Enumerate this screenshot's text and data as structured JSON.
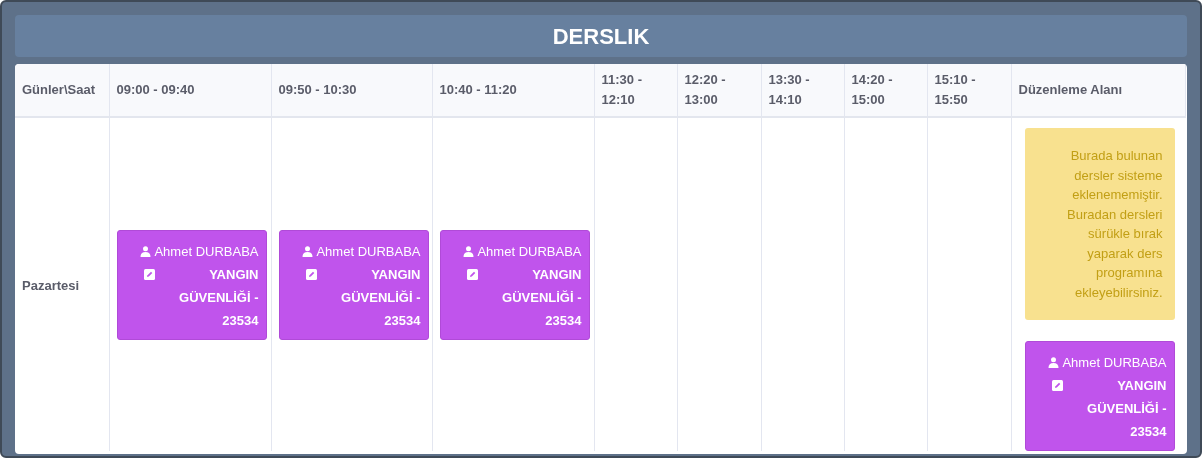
{
  "title": "DERSLIK",
  "columns": [
    "Günler\\Saat",
    "09:00 - 09:40",
    "09:50 - 10:30",
    "10:40 - 11:20",
    "11:30 - 12:10",
    "12:20 - 13:00",
    "13:30 - 14:10",
    "14:20 - 15:00",
    "15:10 - 15:50",
    "Düzenleme Alanı"
  ],
  "rows": [
    {
      "day": "Pazartesi",
      "cells": [
        [
          {
            "teacher": "Ahmet DURBABA",
            "course": "YANGIN GÜVENLİĞİ - 23534"
          }
        ],
        [
          {
            "teacher": "Ahmet DURBABA",
            "course": "YANGIN GÜVENLİĞİ - 23534"
          }
        ],
        [
          {
            "teacher": "Ahmet DURBABA",
            "course": "YANGIN GÜVENLİĞİ - 23534"
          }
        ],
        [],
        [],
        [],
        [],
        []
      ]
    }
  ],
  "editing_area": {
    "note": "Burada bulunan dersler sisteme eklenememiştir. Buradan dersleri sürükle bırak yaparak ders programına ekleyebilirsiniz.",
    "lessons": [
      {
        "teacher": "Ahmet DURBABA",
        "course": "YANGIN GÜVENLİĞİ - 23534"
      }
    ]
  }
}
